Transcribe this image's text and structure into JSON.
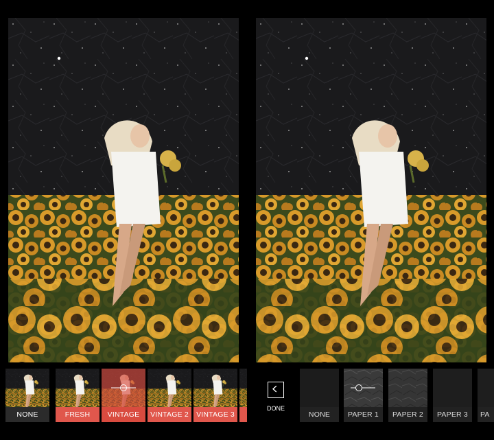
{
  "filters": {
    "items": [
      {
        "label": "NONE"
      },
      {
        "label": "FRESH"
      },
      {
        "label": "VINTAGE"
      },
      {
        "label": "VINTAGE 2"
      },
      {
        "label": "VINTAGE 3"
      }
    ],
    "selected_index": 2
  },
  "textures": {
    "done_label": "DONE",
    "items": [
      {
        "label": "NONE"
      },
      {
        "label": "PAPER 1"
      },
      {
        "label": "PAPER 2"
      },
      {
        "label": "PAPER 3"
      },
      {
        "label": "PA"
      }
    ],
    "selected_index": 1
  },
  "colors": {
    "accent_red": "#e0574c",
    "selected_red": "#d94b3f",
    "background": "#000000"
  }
}
